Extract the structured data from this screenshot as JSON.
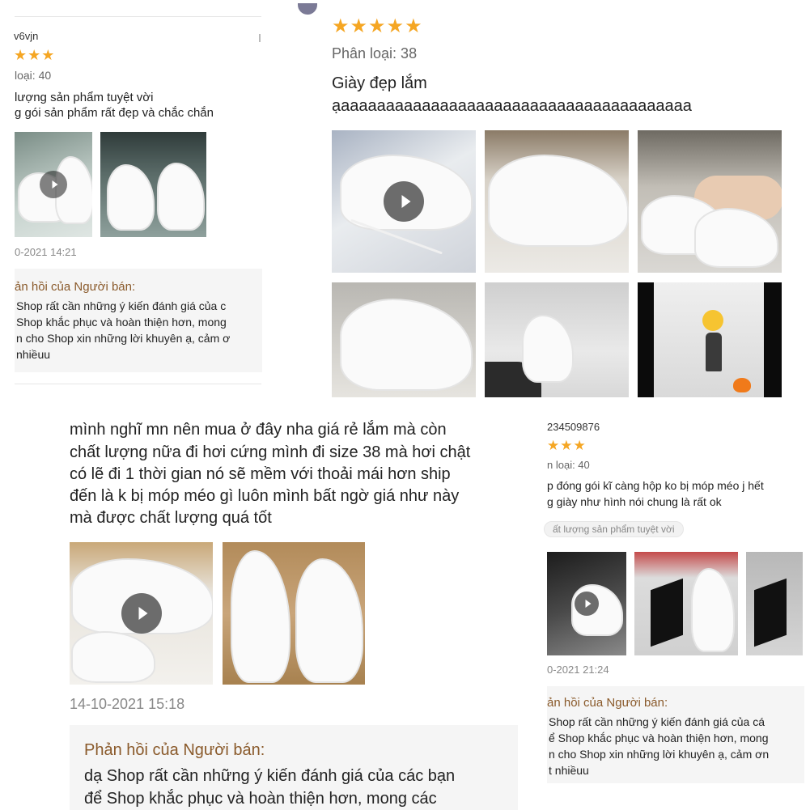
{
  "colors": {
    "star": "#f5a623",
    "reply_title": "#8a5a2b",
    "reply_bg": "#f5f5f5"
  },
  "panel_top_left": {
    "username": "v6vjn",
    "stars": "★★★",
    "variant": "loại: 40",
    "lines": [
      "lượng sản phẩm tuyệt vời",
      "g gói sản phẩm rất đẹp và chắc chắn"
    ],
    "date": "0-2021 14:21",
    "reply_title": "ản hồi của Người bán:",
    "reply_lines": [
      "Shop rất cần những ý kiến đánh giá của c",
      "Shop khắc phục và hoàn thiện hơn, mong",
      "n cho Shop xin những lời khuyên ạ, cảm ơ",
      "nhiềuu"
    ]
  },
  "panel_top_right": {
    "stars": "★★★★★",
    "variant": "Phân loại: 38",
    "lines": [
      "Giày đẹp lắm",
      "ạaaaaaaaaaaaaaaaaaaaaaaaaaaaaaaaaaaaaaaa"
    ]
  },
  "panel_bottom_left": {
    "lines": [
      "mình nghĩ mn nên mua ở đây nha giá rẻ lắm mà còn",
      "chất lượng nữa đi hơi cứng mình đi size 38 mà hơi chật",
      "có lẽ đi 1 thời gian nó sẽ mềm với thoải mái hơn ship",
      "đến là k bị móp méo gì luôn mình bất ngờ giá như này",
      "mà được chất lượng quá tốt"
    ],
    "date": "14-10-2021 15:18",
    "reply_title": "Phản hồi của Người bán:",
    "reply_lines": [
      "dạ Shop rất cần những ý kiến đánh giá của các bạn",
      "để Shop khắc phục và hoàn thiện hơn, mong các"
    ]
  },
  "panel_bottom_right": {
    "username": "234509876",
    "stars": "★★★",
    "variant": "n loại: 40",
    "lines": [
      "p đóng gói kĩ càng hộp ko bị móp méo j hết",
      "g giày như hình nói chung là rất ok"
    ],
    "tag": "ất lượng sản phẩm tuyệt vời",
    "date": "0-2021 21:24",
    "reply_title": "ản hồi của Người bán:",
    "reply_lines": [
      "Shop rất cần những ý kiến đánh giá của cá",
      "ể Shop khắc phục và hoàn thiện hơn, mong",
      "n cho Shop xin những lời khuyên ạ, cảm ơn",
      "t nhiềuu"
    ]
  }
}
